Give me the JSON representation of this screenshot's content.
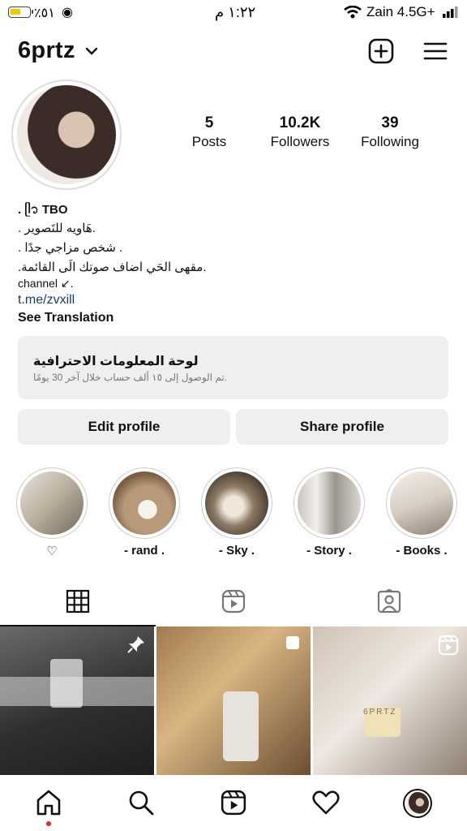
{
  "status_bar": {
    "battery_text": "٪٥١",
    "time": "١:٢٢ م",
    "carrier": "Zain 4.5G+"
  },
  "header": {
    "username": "6prtz"
  },
  "stats": [
    {
      "value": "5",
      "label": "Posts"
    },
    {
      "value": "10.2K",
      "label": "Followers"
    },
    {
      "value": "39",
      "label": "Following"
    }
  ],
  "bio": {
    "line1": ". ᥫ᭡ TBO",
    "line2": ". هَاويه للتَصوير.",
    "line3": ". شخص مزاجي جدًا .",
    "line4": ".مقهى الحَي اضاف صوتك الَى القائمة.",
    "line5": "channel ↙︎.",
    "link": "t.me/zvxill",
    "see_translation": "See Translation"
  },
  "dashboard": {
    "title": "لوحة المعلومات الاحترافية",
    "subtitle": "تم الوصول إلى ١٥ ألف حساب خلال آخر 30 يومًا."
  },
  "buttons": {
    "edit_profile": "Edit profile",
    "share_profile": "Share profile"
  },
  "highlights": [
    {
      "label": "♡"
    },
    {
      "label": "- rand ."
    },
    {
      "label": "- Sky ."
    },
    {
      "label": "- Story ."
    },
    {
      "label": "- Books ."
    }
  ],
  "post_overlay": {
    "watermark": "6PRTZ"
  },
  "icons": {
    "create": "plus-square-icon",
    "menu": "hamburger-menu-icon",
    "grid": "grid-icon",
    "reels": "reels-icon",
    "tagged": "tagged-icon",
    "home": "home-icon",
    "search": "search-icon",
    "heart": "heart-icon"
  },
  "colors": {
    "link": "#1e3a6e",
    "button_bg": "#efefef",
    "notification_dot": "#e0263a"
  }
}
